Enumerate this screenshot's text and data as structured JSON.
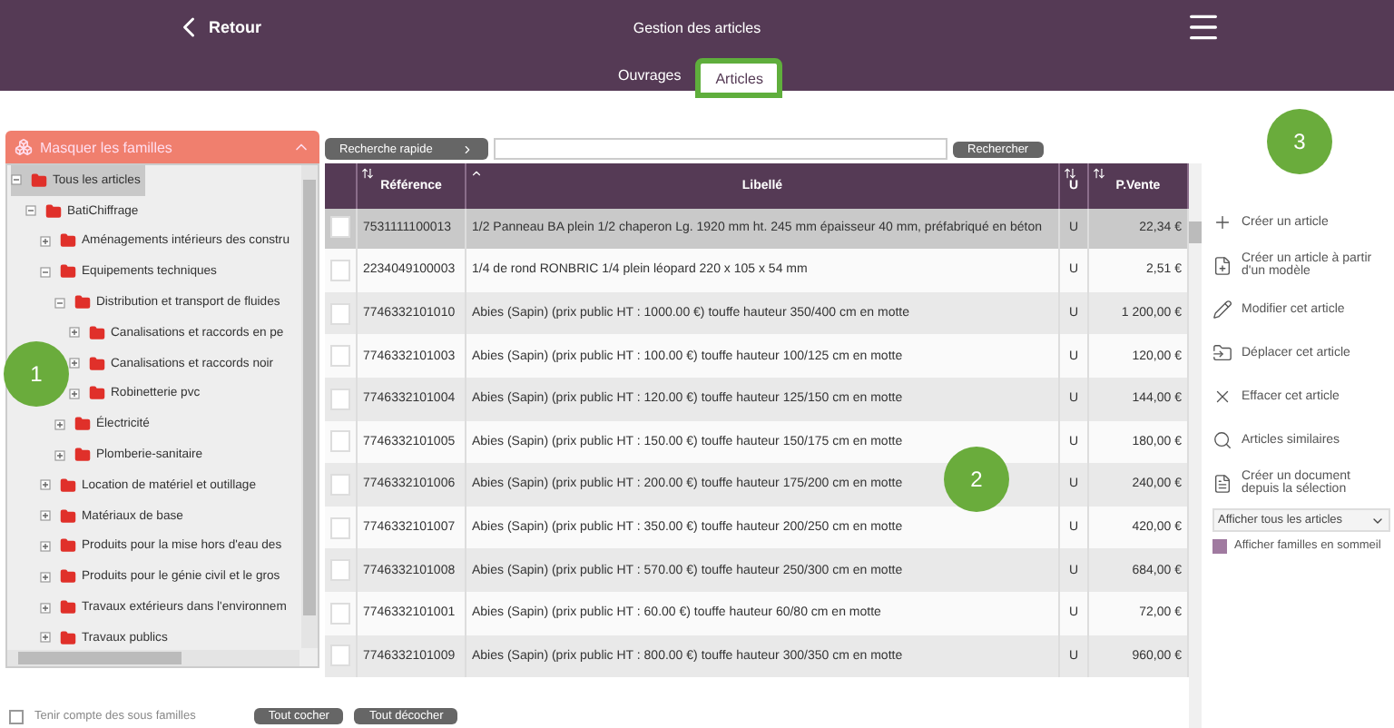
{
  "header": {
    "back": "Retour",
    "title": "Gestion des articles"
  },
  "tabs": [
    {
      "label": "Ouvrages",
      "selected": false
    },
    {
      "label": "Articles",
      "selected": true
    }
  ],
  "families": {
    "toggle": "Masquer les familles",
    "tree": [
      {
        "label": "Tous les articles",
        "expanded": true,
        "selected": true,
        "children": [
          {
            "label": "BatiChiffrage",
            "expanded": true,
            "selected": false,
            "children": [
              {
                "label": "Aménagements intérieurs des constru",
                "expanded": false,
                "selected": false
              },
              {
                "label": "Equipements techniques",
                "expanded": true,
                "selected": false,
                "children": [
                  {
                    "label": "Distribution et transport de fluides",
                    "expanded": true,
                    "selected": false,
                    "children": [
                      {
                        "label": "Canalisations et raccords en pe",
                        "expanded": false,
                        "selected": false
                      },
                      {
                        "label": "Canalisations et raccords noir",
                        "expanded": false,
                        "selected": false
                      },
                      {
                        "label": "Robinetterie pvc",
                        "expanded": false,
                        "selected": false
                      }
                    ]
                  },
                  {
                    "label": "Électricité",
                    "expanded": false,
                    "selected": false
                  },
                  {
                    "label": "Plomberie-sanitaire",
                    "expanded": false,
                    "selected": false
                  }
                ]
              },
              {
                "label": "Location de matériel et outillage",
                "expanded": false,
                "selected": false
              },
              {
                "label": "Matériaux de base",
                "expanded": false,
                "selected": false
              },
              {
                "label": "Produits pour la mise hors d'eau des",
                "expanded": false,
                "selected": false
              },
              {
                "label": "Produits pour le génie civil et le gros",
                "expanded": false,
                "selected": false
              },
              {
                "label": "Travaux extérieurs dans l'environnem",
                "expanded": false,
                "selected": false
              },
              {
                "label": "Travaux publics",
                "expanded": false,
                "selected": false
              }
            ]
          }
        ]
      }
    ],
    "subfamilies": {
      "label": "Tenir compte des sous familles",
      "checked": false
    },
    "buttons": [
      "Tout cocher",
      "Tout décocher"
    ]
  },
  "search": {
    "quick": "Recherche rapide",
    "button": "Rechercher"
  },
  "table": {
    "columns": [
      "Référence",
      "Libellé",
      "U",
      "P.Vente"
    ],
    "rows": [
      {
        "ref": "7531111100013",
        "label": "1/2 Panneau BA plein 1/2 chaperon Lg. 1920 mm ht. 245 mm épaisseur 40 mm, préfabriqué en béton",
        "unit": "U",
        "price": "22,34 €",
        "checked": false,
        "selected": true
      },
      {
        "ref": "2234049100003",
        "label": "1/4 de rond RONBRIC 1/4 plein léopard 220 x 105 x 54 mm",
        "unit": "U",
        "price": "2,51 €",
        "checked": false,
        "selected": false
      },
      {
        "ref": "7746332101010",
        "label": "Abies (Sapin) (prix public HT : 1000.00 €) touffe hauteur 350/400 cm en motte",
        "unit": "U",
        "price": "1 200,00 €",
        "checked": false,
        "selected": false
      },
      {
        "ref": "7746332101003",
        "label": "Abies (Sapin) (prix public HT : 100.00 €) touffe hauteur 100/125 cm en motte",
        "unit": "U",
        "price": "120,00 €",
        "checked": false,
        "selected": false
      },
      {
        "ref": "7746332101004",
        "label": "Abies (Sapin) (prix public HT : 120.00 €) touffe hauteur 125/150 cm en motte",
        "unit": "U",
        "price": "144,00 €",
        "checked": false,
        "selected": false
      },
      {
        "ref": "7746332101005",
        "label": "Abies (Sapin) (prix public HT : 150.00 €) touffe hauteur 150/175 cm en motte",
        "unit": "U",
        "price": "180,00 €",
        "checked": false,
        "selected": false
      },
      {
        "ref": "7746332101006",
        "label": "Abies (Sapin) (prix public HT : 200.00 €) touffe hauteur 175/200 cm en motte",
        "unit": "U",
        "price": "240,00 €",
        "checked": false,
        "selected": false
      },
      {
        "ref": "7746332101007",
        "label": "Abies (Sapin) (prix public HT : 350.00 €) touffe hauteur 200/250 cm en motte",
        "unit": "U",
        "price": "420,00 €",
        "checked": false,
        "selected": false
      },
      {
        "ref": "7746332101008",
        "label": "Abies (Sapin) (prix public HT : 570.00 €) touffe hauteur 250/300 cm en motte",
        "unit": "U",
        "price": "684,00 €",
        "checked": false,
        "selected": false
      },
      {
        "ref": "7746332101001",
        "label": "Abies (Sapin) (prix public HT : 60.00 €) touffe hauteur 60/80 cm en motte",
        "unit": "U",
        "price": "72,00 €",
        "checked": false,
        "selected": false
      },
      {
        "ref": "7746332101009",
        "label": "Abies (Sapin) (prix public HT : 800.00 €) touffe hauteur 300/350 cm en motte",
        "unit": "U",
        "price": "960,00 €",
        "checked": false,
        "selected": false
      }
    ]
  },
  "actions": [
    {
      "kind": "create",
      "label": "Créer un article"
    },
    {
      "kind": "template",
      "label": "Créer un article à partir d'un modèle"
    },
    {
      "kind": "edit",
      "label": "Modifier cet article"
    },
    {
      "kind": "move",
      "label": "Déplacer cet article"
    },
    {
      "kind": "delete",
      "label": "Effacer cet article"
    },
    {
      "kind": "similar",
      "label": "Articles similaires"
    },
    {
      "kind": "document",
      "label": "Créer un document depuis la sélection"
    }
  ],
  "filter": {
    "value": "Afficher tous les articles"
  },
  "dormant": {
    "label": "Afficher familles en sommeil",
    "checked": true
  },
  "annotations": [
    {
      "label": "1"
    },
    {
      "label": "2"
    },
    {
      "label": "3"
    }
  ]
}
